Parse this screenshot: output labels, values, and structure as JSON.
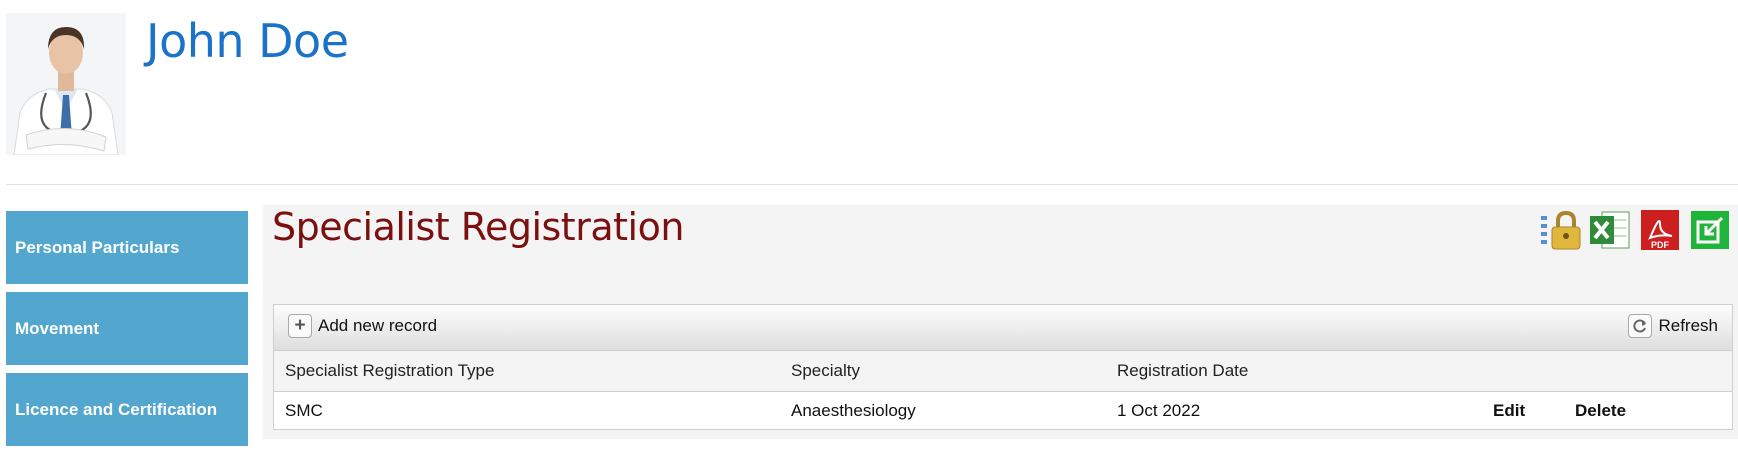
{
  "profile": {
    "name": "John Doe"
  },
  "sidebar": {
    "items": [
      {
        "label": "Personal Particulars"
      },
      {
        "label": "Movement"
      },
      {
        "label": "Licence and Certification"
      }
    ]
  },
  "main": {
    "title": "Specialist Registration",
    "toolbar_icons": [
      "lock-checklist-icon",
      "excel-icon",
      "pdf-icon",
      "export-icon"
    ],
    "pdf_label": "PDF",
    "colors": {
      "title": "#7b1010",
      "name": "#1a73c9",
      "sidebar": "#53a7cf"
    }
  },
  "grid": {
    "add_label": "Add new record",
    "refresh_label": "Refresh",
    "columns": [
      "Specialist Registration Type",
      "Specialty",
      "Registration Date"
    ],
    "rows": [
      {
        "type": "SMC",
        "specialty": "Anaesthesiology",
        "date": "1 Oct 2022",
        "edit": "Edit",
        "delete": "Delete"
      }
    ]
  }
}
